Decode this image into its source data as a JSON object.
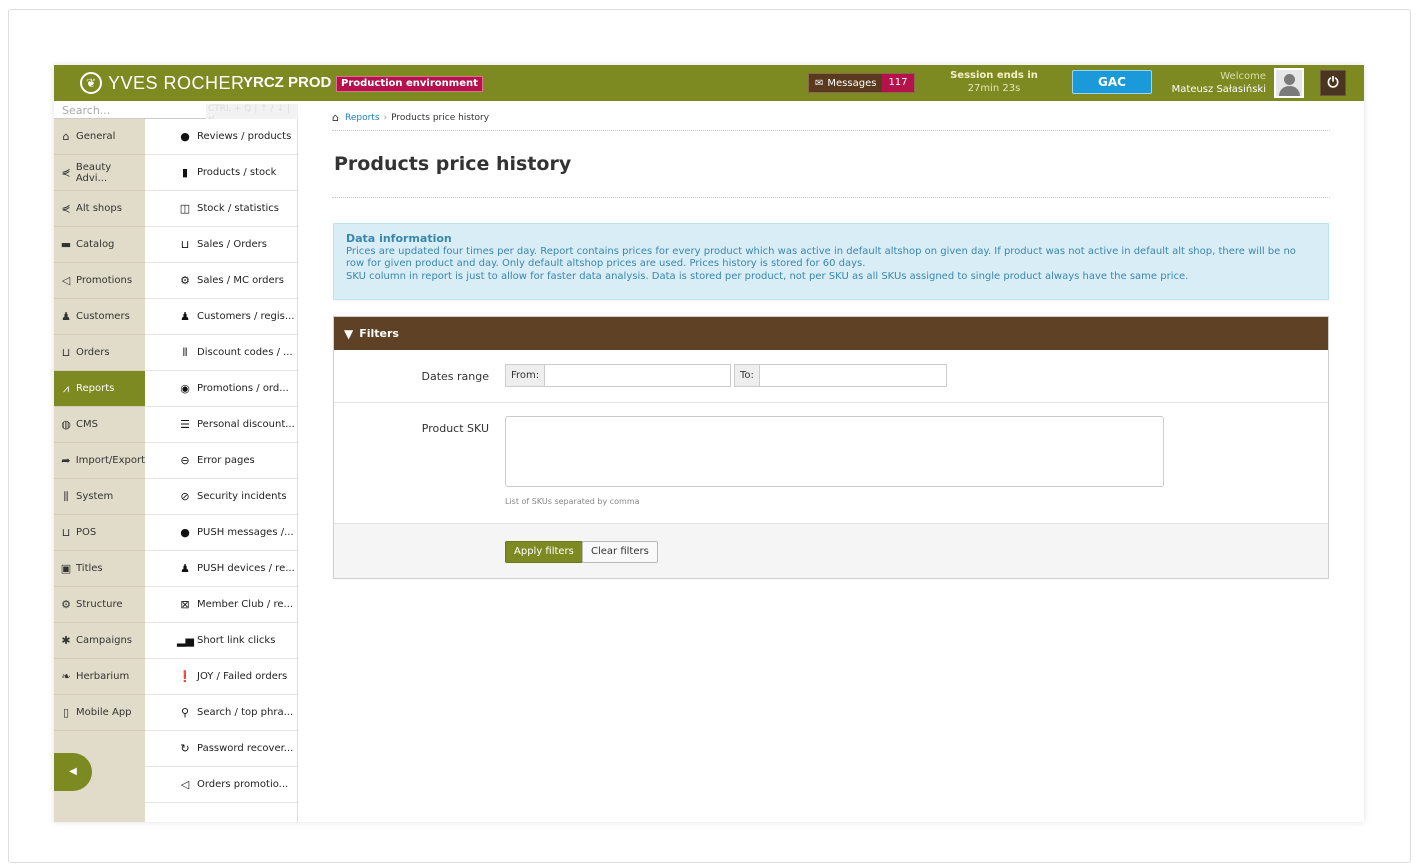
{
  "header": {
    "brand": "YVES ROCHER",
    "env_name": "YRCZ PROD",
    "env_badge": "Production environment",
    "messages_label": "Messages",
    "messages_count": "117",
    "session_title": "Session ends in",
    "session_time": "27min 23s",
    "gac_label": "GAC",
    "welcome_label": "Welcome",
    "user_name": "Mateusz Sałasiński"
  },
  "search": {
    "placeholder": "Search...",
    "shortcut_hint": "CTRL + Q | ↑ / ↓ | ↵"
  },
  "sidebar": {
    "items": [
      {
        "label": "General",
        "icon": "home-icon"
      },
      {
        "label": "Beauty Advi...",
        "icon": "share-icon"
      },
      {
        "label": "Alt shops",
        "icon": "share-icon"
      },
      {
        "label": "Catalog",
        "icon": "folder-icon"
      },
      {
        "label": "Promotions",
        "icon": "megaphone-icon"
      },
      {
        "label": "Customers",
        "icon": "users-icon"
      },
      {
        "label": "Orders",
        "icon": "cart-icon"
      },
      {
        "label": "Reports",
        "icon": "chart-icon",
        "active": true
      },
      {
        "label": "CMS",
        "icon": "globe-icon"
      },
      {
        "label": "Import/Export",
        "icon": "arrow-icon"
      },
      {
        "label": "System",
        "icon": "sliders-icon"
      },
      {
        "label": "POS",
        "icon": "pos-cart-icon"
      },
      {
        "label": "Titles",
        "icon": "titles-icon"
      },
      {
        "label": "Structure",
        "icon": "sitemap-icon"
      },
      {
        "label": "Campaigns",
        "icon": "asterisk-icon"
      },
      {
        "label": "Herbarium",
        "icon": "leaf-icon"
      },
      {
        "label": "Mobile App",
        "icon": "mobile-icon"
      }
    ]
  },
  "submenu": {
    "items": [
      {
        "label": "Reviews / products",
        "icon": "comments-icon"
      },
      {
        "label": "Products / stock",
        "icon": "trash-icon"
      },
      {
        "label": "Stock / statistics",
        "icon": "presentation-icon"
      },
      {
        "label": "Sales / Orders",
        "icon": "cart-icon"
      },
      {
        "label": "Sales / MC orders",
        "icon": "sitemap-icon"
      },
      {
        "label": "Customers / regis...",
        "icon": "users-icon"
      },
      {
        "label": "Discount codes / ...",
        "icon": "barcode-icon"
      },
      {
        "label": "Promotions / ord...",
        "icon": "eye-icon"
      },
      {
        "label": "Personal discount...",
        "icon": "list-icon"
      },
      {
        "label": "Error pages",
        "icon": "minus-circle-icon"
      },
      {
        "label": "Security incidents",
        "icon": "ban-icon"
      },
      {
        "label": "PUSH messages /...",
        "icon": "comments-icon"
      },
      {
        "label": "PUSH devices / re...",
        "icon": "add-user-icon"
      },
      {
        "label": "Member Club / re...",
        "icon": "excel-icon"
      },
      {
        "label": "Short link clicks",
        "icon": "bar-chart-icon"
      },
      {
        "label": "JOY / Failed orders",
        "icon": "exclamation-icon"
      },
      {
        "label": "Search / top phra...",
        "icon": "search-icon"
      },
      {
        "label": "Password recover...",
        "icon": "refresh-icon"
      },
      {
        "label": "Orders promotio...",
        "icon": "megaphone-icon"
      }
    ]
  },
  "breadcrumb": {
    "parent": "Reports",
    "current": "Products price history"
  },
  "page": {
    "title": "Products price history"
  },
  "info": {
    "title": "Data information",
    "line1": "Prices are updated four times per day. Report contains prices for every product which was active in default altshop on given day. If product was not active in default alt shop, there will be no row for given product and day. Only default altshop prices are used. Prices history is stored for 60 days.",
    "line2": "SKU column in report is just to allow for faster data analysis. Data is stored per product, not per SKU as all SKUs assigned to single product always have the same price."
  },
  "filters": {
    "title": "Filters",
    "dates_label": "Dates range",
    "from_label": "From:",
    "from_value": "",
    "to_label": "To:",
    "to_value": "",
    "sku_label": "Product SKU",
    "sku_value": "",
    "sku_help": "List of SKUs separated by comma",
    "apply_label": "Apply filters",
    "clear_label": "Clear filters"
  },
  "colors": {
    "brand_green": "#7d8a22",
    "filter_header_brown": "#5f4226",
    "badge_red": "#b3124b",
    "gac_blue": "#1a9ad9",
    "info_bg": "#d9edf7",
    "sidebar_bg": "#e1dcc9"
  }
}
